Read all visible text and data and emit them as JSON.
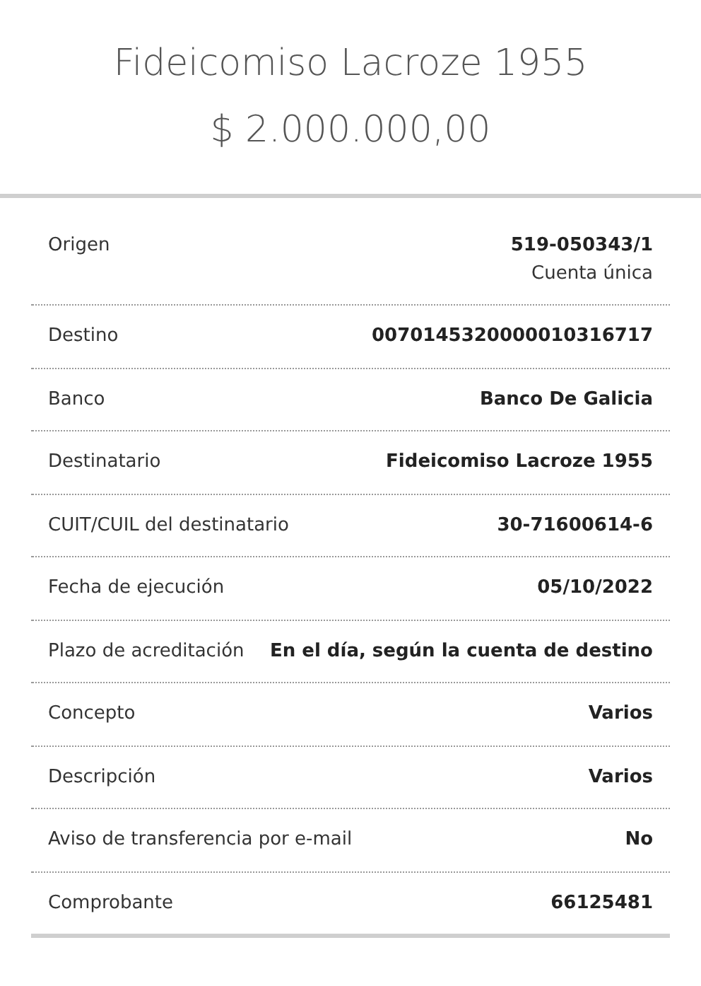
{
  "header": {
    "title": "Fideicomiso Lacroze 1955",
    "amount": "$ 2.000.000,00"
  },
  "rows": [
    {
      "label": "Origen",
      "value": "519-050343/1",
      "detail": "Cuenta única"
    },
    {
      "label": "Destino",
      "value": "0070145320000010316717"
    },
    {
      "label": "Banco",
      "value": "Banco De Galicia"
    },
    {
      "label": "Destinatario",
      "value": "Fideicomiso Lacroze 1955"
    },
    {
      "label": "CUIT/CUIL del destinatario",
      "value": "30-71600614-6"
    },
    {
      "label": "Fecha de ejecución",
      "value": "05/10/2022"
    },
    {
      "label": "Plazo de acreditación",
      "value": "En el día, según la cuenta de destino"
    },
    {
      "label": "Concepto",
      "value": "Varios"
    },
    {
      "label": "Descripción",
      "value": "Varios"
    },
    {
      "label": "Aviso de transferencia por e-mail",
      "value": "No"
    },
    {
      "label": "Comprobante",
      "value": "66125481"
    }
  ]
}
